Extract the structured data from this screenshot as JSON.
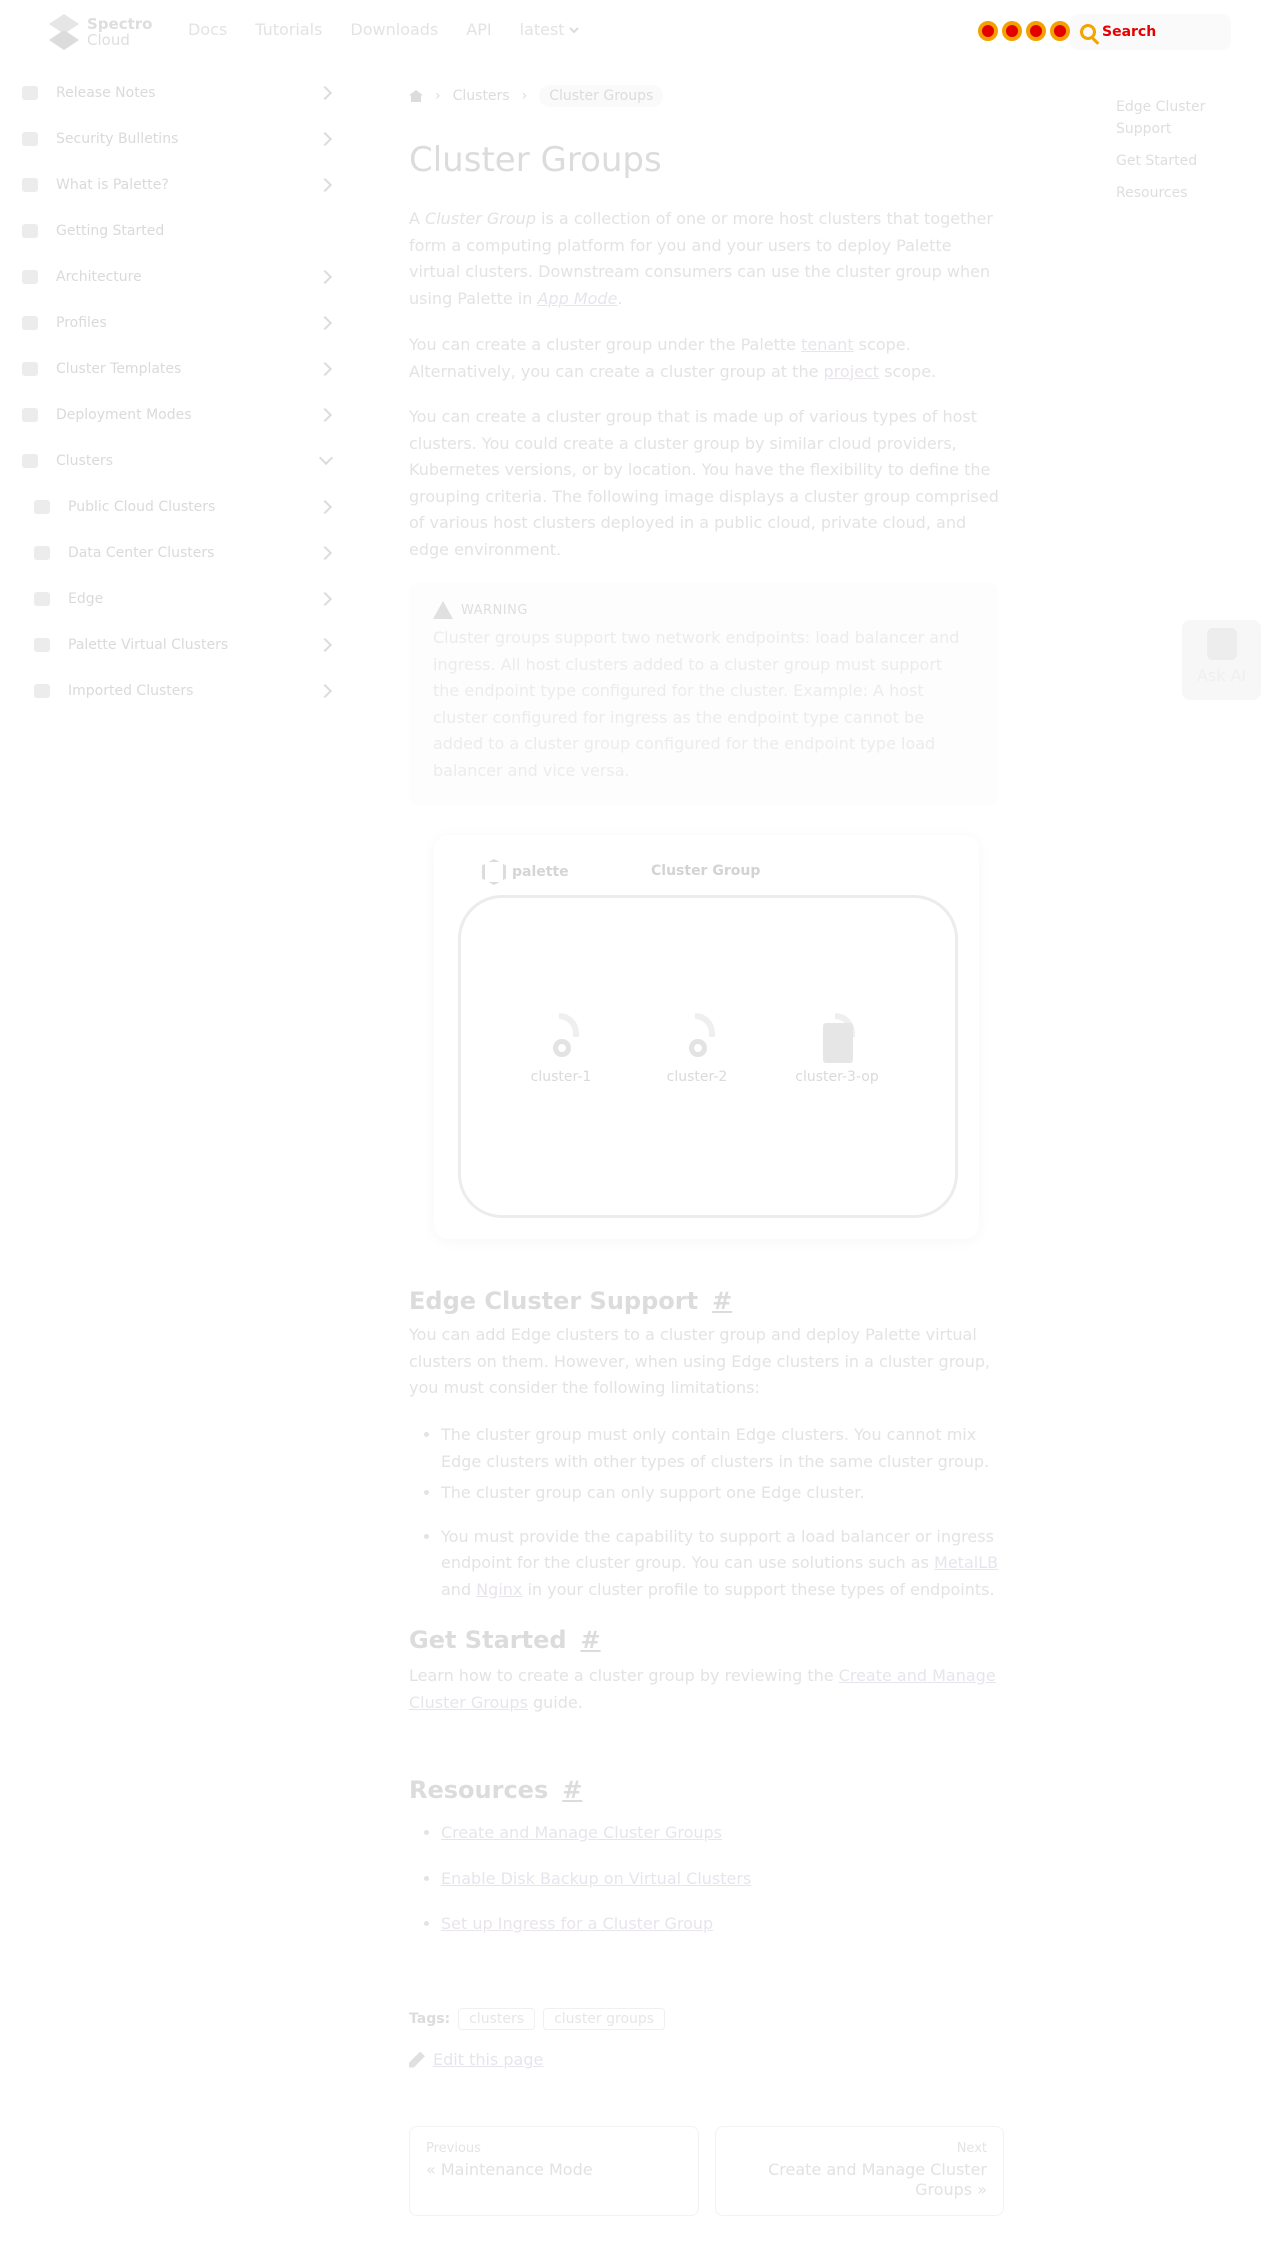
{
  "brand": {
    "name_line1": "Spectro",
    "name_line2": "Cloud"
  },
  "nav": {
    "links": [
      "Docs",
      "Tutorials",
      "Downloads",
      "API"
    ],
    "version": "latest",
    "search_placeholder": "Search"
  },
  "sidebar": {
    "items": [
      {
        "label": "Release Notes",
        "icon": "file-icon",
        "chevron": "right"
      },
      {
        "label": "Security Bulletins",
        "icon": "shield-icon",
        "chevron": "right"
      },
      {
        "label": "What is Palette?",
        "icon": "brain-icon",
        "chevron": "right"
      },
      {
        "label": "Getting Started",
        "icon": "rocket-icon",
        "chevron": "none"
      },
      {
        "label": "Architecture",
        "icon": "building-icon",
        "chevron": "right"
      },
      {
        "label": "Profiles",
        "icon": "layers-icon",
        "chevron": "right"
      },
      {
        "label": "Cluster Templates",
        "icon": "template-icon",
        "chevron": "right"
      },
      {
        "label": "Deployment Modes",
        "icon": "deploy-icon",
        "chevron": "right"
      },
      {
        "label": "Clusters",
        "icon": "clusters-icon",
        "chevron": "down"
      }
    ],
    "subitems": [
      {
        "label": "Public Cloud Clusters",
        "icon": "cloud-icon"
      },
      {
        "label": "Data Center Clusters",
        "icon": "server-icon"
      },
      {
        "label": "Edge",
        "icon": "edge-icon"
      },
      {
        "label": "Palette Virtual Clusters",
        "icon": "virtual-icon"
      },
      {
        "label": "Imported Clusters",
        "icon": "import-icon"
      }
    ]
  },
  "breadcrumb": {
    "parent": "Clusters",
    "current": "Cluster Groups",
    "separator": "›"
  },
  "title": "Cluster Groups",
  "intro": {
    "p1_a": "A ",
    "p1_em": "Cluster Group",
    "p1_b": " is a collection of one or more host clusters that together form a computing platform for you and your users to deploy Palette virtual clusters. Downstream consumers can use the cluster group when using Palette in ",
    "p1_link": "App Mode",
    "p1_c": ".",
    "p2_a": "You can create a cluster group under the Palette ",
    "p2_link1": "tenant",
    "p2_b": " scope. Alternatively, you can create a cluster group at the ",
    "p2_link2": "project",
    "p2_c": " scope.",
    "p3": "You can create a cluster group that is made up of various types of host clusters. You could create a cluster group by similar cloud providers, Kubernetes versions, or by location. You have the flexibility to define the grouping criteria. The following image displays a cluster group comprised of various host clusters deployed in a public cloud, private cloud, and edge environment."
  },
  "warning": {
    "label": "WARNING",
    "body": "Cluster groups support two network endpoints: load balancer and ingress. All host clusters added to a cluster group must support the endpoint type configured for the cluster. Example: A host cluster configured for ingress as the endpoint type cannot be added to a cluster group configured for the endpoint type load balancer and vice versa."
  },
  "diagram": {
    "logo": "palette",
    "title": "Cluster Group",
    "clusters": [
      "cluster-1",
      "cluster-2",
      "cluster-3-op"
    ]
  },
  "edge": {
    "heading": "Edge Cluster Support",
    "hash": "#",
    "p": "You can add Edge clusters to a cluster group and deploy Palette virtual clusters on them. However, when using Edge clusters in a cluster group, you must consider the following limitations:",
    "li1": "The cluster group must only contain Edge clusters. You cannot mix Edge clusters with other types of clusters in the same cluster group.",
    "li2": "The cluster group can only support one Edge cluster.",
    "li3_a": "You must provide the capability to support a load balancer or ingress endpoint for the cluster group. You can use solutions such as ",
    "li3_link1": "MetalLB",
    "li3_b": " and ",
    "li3_link2": "Nginx",
    "li3_c": " in your cluster profile to support these types of endpoints."
  },
  "get_started": {
    "heading": "Get Started",
    "hash": "#",
    "p_a": "Learn how to create a cluster group by reviewing the ",
    "p_link": "Create and Manage Cluster Groups",
    "p_b": " guide."
  },
  "resources": {
    "heading": "Resources",
    "hash": "#",
    "links": [
      "Create and Manage Cluster Groups",
      "Enable Disk Backup on Virtual Clusters",
      "Set up Ingress for a Cluster Group"
    ]
  },
  "tags": {
    "label": "Tags:",
    "items": [
      "clusters",
      "cluster groups"
    ]
  },
  "edit": "Edit this page",
  "pager": {
    "prev_label": "Previous",
    "prev_title": "« Maintenance Mode",
    "next_label": "Next",
    "next_title": "Create and Manage Cluster Groups »"
  },
  "toc": [
    "Edge Cluster Support",
    "Get Started",
    "Resources"
  ],
  "ask_ai": "Ask AI",
  "colors": {
    "accent": "#e8e4ec",
    "warning_bg": "#fdfdfd"
  }
}
